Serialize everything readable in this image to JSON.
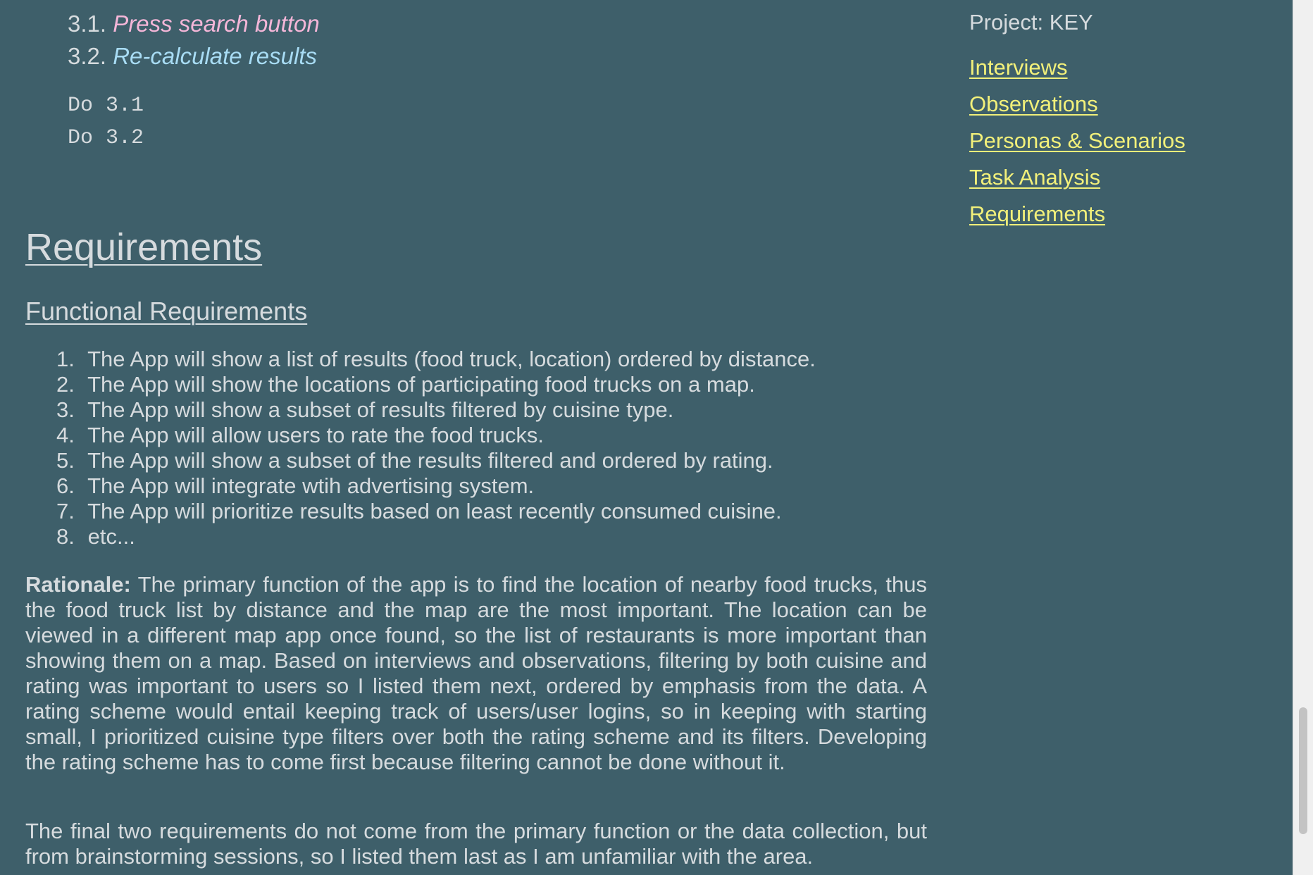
{
  "steps": [
    {
      "num": "3.1.",
      "text": "Press search button"
    },
    {
      "num": "3.2.",
      "text": "Re-calculate results"
    }
  ],
  "code_lines": [
    "Do 3.1",
    "Do 3.2"
  ],
  "requirements_heading": "Requirements",
  "functional_heading": "Functional Requirements",
  "functional_requirements": [
    {
      "num": "1.",
      "text": "The App will show a list of results (food truck, location) ordered by distance."
    },
    {
      "num": "2.",
      "text": "The App will show the locations of participating food trucks on a map."
    },
    {
      "num": "3.",
      "text": "The App will show a subset of results filtered by cuisine type."
    },
    {
      "num": "4.",
      "text": "The App will allow users to rate the food trucks."
    },
    {
      "num": "5.",
      "text": "The App will show a subset of the results filtered and ordered by rating."
    },
    {
      "num": "6.",
      "text": "The App will integrate wtih advertising system."
    },
    {
      "num": "7.",
      "text": "The App will prioritize results based on least recently consumed cuisine."
    },
    {
      "num": "8.",
      "text": "etc..."
    }
  ],
  "rationale": {
    "label": "Rationale:",
    "text": " The primary function of the app is to find the location of nearby food trucks, thus the food truck list by distance and the map are the most important. The location can be viewed in a different map app once found, so the list of restaurants is more important than showing them on a map. Based on interviews and observations, filtering by both cuisine and rating was important to users so I listed them next, ordered by emphasis from the data. A rating scheme would entail keeping track of users/user logins, so in keeping with starting small, I prioritized cuisine type filters over both the rating scheme and its filters. Developing the rating scheme has to come first because filtering cannot be done without it."
  },
  "final_paragraph": "The final two requirements do not come from the primary function or the data collection, but from brainstorming sessions, so I listed them last as I am unfamiliar with the area.",
  "sidebar": {
    "project_label": "Project: KEY",
    "links": [
      {
        "label": "Interviews"
      },
      {
        "label": "Observations"
      },
      {
        "label": "Personas & Scenarios"
      },
      {
        "label": "Task Analysis"
      },
      {
        "label": "Requirements"
      }
    ]
  },
  "colors": {
    "background": "#3e5f6a",
    "body_text": "#d6dbde",
    "link": "#f2f07a",
    "step_1_accent": "#f4b6d8",
    "step_2_accent": "#a8dcf4"
  }
}
